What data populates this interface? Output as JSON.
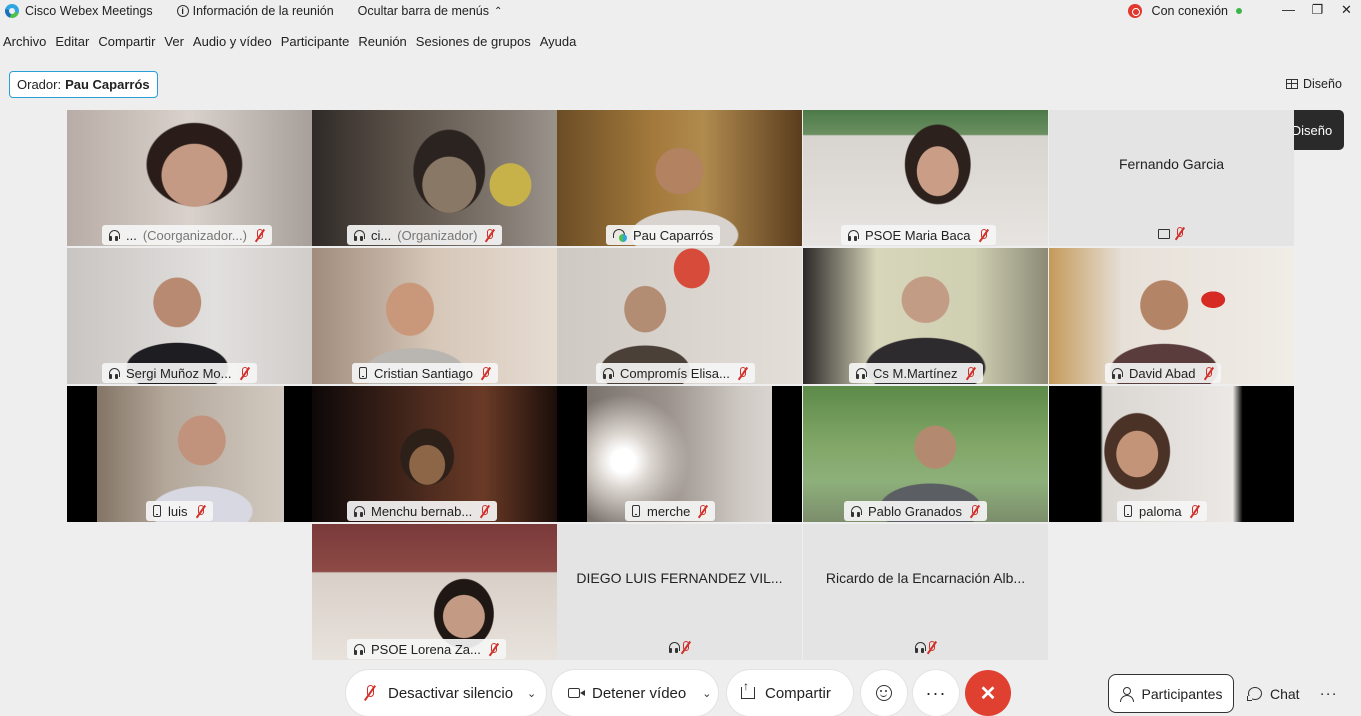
{
  "titlebar": {
    "app_name": "Cisco Webex Meetings",
    "meeting_info": "Información de la reunión",
    "hide_menu": "Ocultar barra de menús",
    "connection": "Con conexión",
    "minimize": "—",
    "maximize": "❐",
    "close": "✕"
  },
  "menu": [
    "Archivo",
    "Editar",
    "Compartir",
    "Ver",
    "Audio y vídeo",
    "Participante",
    "Reunión",
    "Sesiones de grupos",
    "Ayuda"
  ],
  "speaker": {
    "label": "Orador:",
    "name": "Pau Caparrós"
  },
  "layout_button": "Diseño",
  "tooltip": "Diseño",
  "tiles": {
    "t1": {
      "name": "...",
      "role": "(Coorganizador...)"
    },
    "t2": {
      "name": "ci...",
      "role": "(Organizador)"
    },
    "t3": {
      "name": "Pau Caparrós"
    },
    "t4": {
      "name": "PSOE Maria Baca"
    },
    "t5": {
      "name": "Fernando Garcia"
    },
    "t6": {
      "name": "Sergi Muñoz Mo..."
    },
    "t7": {
      "name": "Cristian Santiago"
    },
    "t8": {
      "name": "Compromís Elisa..."
    },
    "t9": {
      "name": "Cs M.Martínez"
    },
    "t10": {
      "name": "David Abad"
    },
    "t11": {
      "name": "luis"
    },
    "t12": {
      "name": "Menchu bernab..."
    },
    "t13": {
      "name": "merche"
    },
    "t14": {
      "name": "Pablo Granados"
    },
    "t15": {
      "name": "paloma"
    },
    "t16": {
      "name": "PSOE Lorena Za..."
    },
    "t17": {
      "name": "DIEGO LUIS FERNANDEZ VIL..."
    },
    "t18": {
      "name": "Ricardo de la Encarnación Alb..."
    }
  },
  "controls": {
    "unmute": "Desactivar silencio",
    "stop_video": "Detener vídeo",
    "share": "Compartir",
    "participants": "Participantes",
    "chat": "Chat",
    "more": "···"
  },
  "colors": {
    "accent": "#2aa3dc",
    "end_call": "#e0402f",
    "muted": "#d2302a"
  }
}
